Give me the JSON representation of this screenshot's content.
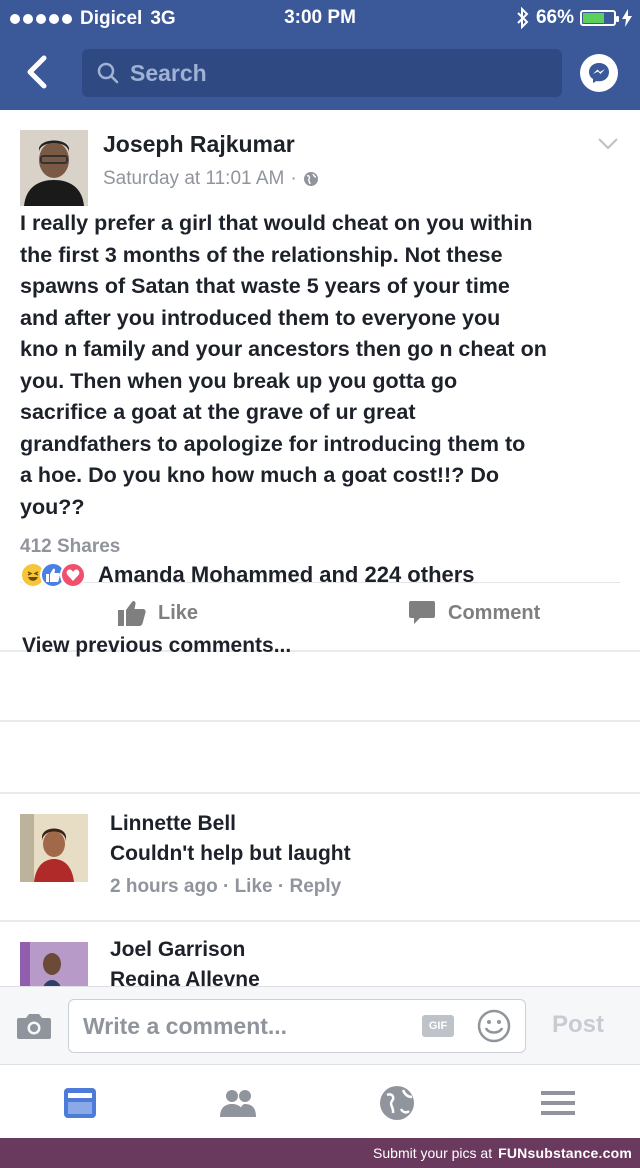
{
  "status_bar": {
    "carrier": "Digicel",
    "network": "3G",
    "time": "3:00 PM",
    "battery": "66%",
    "battery_level": 0.66
  },
  "nav": {
    "search_placeholder": "Search"
  },
  "post": {
    "author": "Joseph Rajkumar",
    "timestamp": "Saturday at 11:01 AM",
    "meta_separator": "·",
    "text_lines": [
      "I really prefer a girl that would cheat on you within",
      "the first 3 months of the relationship. Not these",
      "spawns of Satan that waste 5 years of your time",
      "and after you introduced them to everyone you",
      "kno n family and your ancestors then go n cheat on",
      "you. Then when you break up you gotta go",
      "sacrifice a goat at the grave of ur great",
      "grandfathers to apologize for introducing them to",
      "a hoe. Do you kno how much a goat cost!!? Do",
      "you??"
    ],
    "shares": "412 Shares",
    "like_label": "Like",
    "comment_label": "Comment"
  },
  "reactions": {
    "text": "Amanda Mohammed and 224 others",
    "icons": [
      "haha-icon",
      "like-icon",
      "love-icon"
    ]
  },
  "comments": {
    "view_previous": "View previous comments...",
    "items": [
      {
        "name": "Linnette Bell",
        "text": "Couldn't help but laught",
        "time": "2 hours ago",
        "like": "Like",
        "reply": "Reply",
        "sep": "·"
      },
      {
        "name": "Joel Garrison",
        "text": "Regina Allevne"
      }
    ]
  },
  "composer": {
    "placeholder": "Write a comment...",
    "gif_label": "GIF",
    "post_label": "Post"
  },
  "footer": {
    "text": "Submit your pics at",
    "brand": "FUNsubstance.com"
  },
  "colors": {
    "brand": "#3b5998",
    "meta": "#90949c",
    "footer": "#6a3a5e"
  }
}
